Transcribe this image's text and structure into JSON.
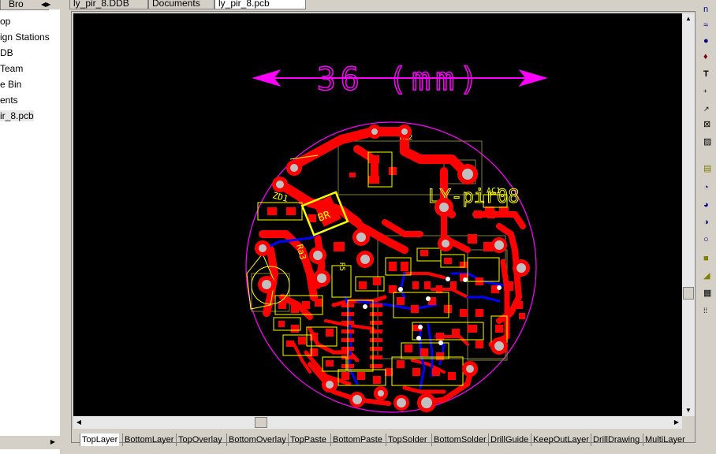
{
  "left_panel": {
    "tab_label": "Bro",
    "items": [
      {
        "label": "op"
      },
      {
        "label": "ign Stations"
      },
      {
        "label": "DB"
      },
      {
        "label": " Team"
      },
      {
        "label": "e Bin"
      },
      {
        "label": "ents"
      },
      {
        "label": "ir_8.pcb"
      }
    ]
  },
  "doc_tabs": [
    {
      "label": "ly_pir_8.DDB"
    },
    {
      "label": "Documents"
    },
    {
      "label": "ly_pir_8.pcb"
    }
  ],
  "pcb": {
    "dimension_label": "36 (mm)",
    "board_label": "LY-pir08",
    "component_labels": {
      "zd1": "ZD1",
      "br": "BR",
      "ra3": "Ra3",
      "ac1": "AC1",
      "ac2": "AC2",
      "r5": "R5",
      "three": "3"
    },
    "colors": {
      "background": "#000000",
      "top_layer": "#ff0000",
      "bottom_layer": "#0000ff",
      "top_overlay": "#ffff00",
      "mechanical": "#ff00ff",
      "keepout": "#808040",
      "pad_hole": "#c0c0c0"
    }
  },
  "layer_tabs": [
    {
      "label": "TopLayer"
    },
    {
      "label": "BottomLayer"
    },
    {
      "label": "TopOverlay"
    },
    {
      "label": "BottomOverlay"
    },
    {
      "label": "TopPaste"
    },
    {
      "label": "BottomPaste"
    },
    {
      "label": "TopSolder"
    },
    {
      "label": "BottomSolder"
    },
    {
      "label": "DrillGuide"
    },
    {
      "label": "KeepOutLayer"
    },
    {
      "label": "DrillDrawing"
    },
    {
      "label": "MultiLayer"
    }
  ],
  "toolbar_icons": [
    "arc-icon",
    "wave-icon",
    "point-icon",
    "pin-icon",
    "text-icon",
    "coordinate-icon",
    "dimension-icon",
    "origin-icon",
    "hatch-icon",
    "component-icon",
    "arc-center-icon",
    "arc-edge-icon",
    "arc-any-icon",
    "circle-icon",
    "fill-icon",
    "polygon-icon",
    "layer-stack-icon",
    "grid-icon"
  ],
  "window_label": "n"
}
